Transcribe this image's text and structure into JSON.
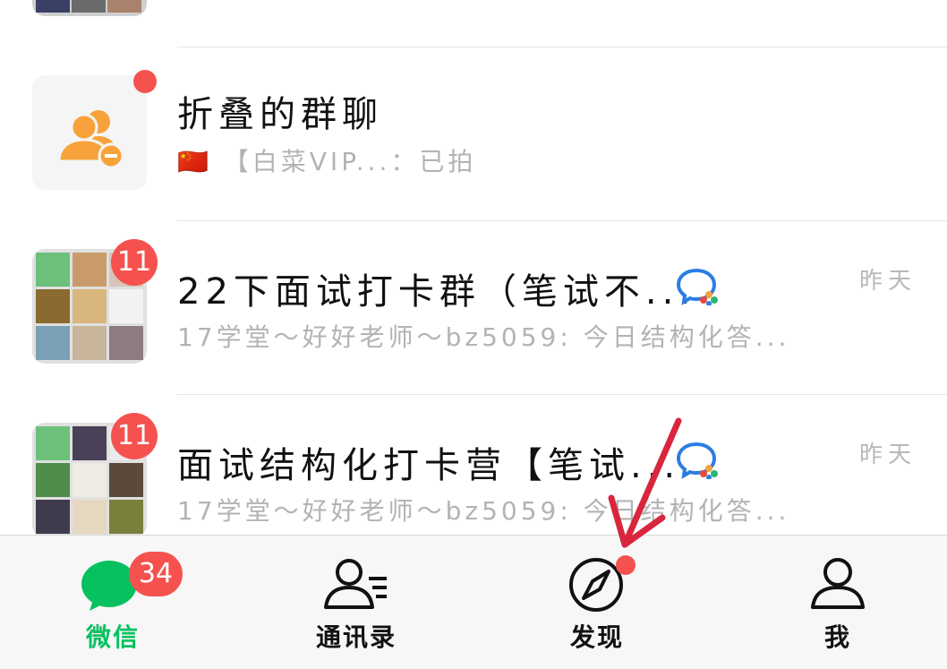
{
  "chats": [
    {
      "title": "折叠的群聊",
      "flag": "🇨🇳",
      "preview": "【白菜VIP...：已拍",
      "time": "",
      "badge": ""
    },
    {
      "title": "22下面试打卡群（笔试不...",
      "flag": "",
      "preview": "17学堂～好好老师～bz5059: 今日结构化答...",
      "time": "昨天",
      "badge": "11"
    },
    {
      "title": "面试结构化打卡营【笔试...",
      "flag": "",
      "preview": "17学堂～好好老师～bz5059: 今日结构化答...",
      "time": "昨天",
      "badge": "11"
    }
  ],
  "tabbar": {
    "items": [
      {
        "label": "微信",
        "icon": "chat-bubble-icon",
        "badge": "34",
        "active": true
      },
      {
        "label": "通讯录",
        "icon": "contacts-icon",
        "badge": "",
        "active": false
      },
      {
        "label": "发现",
        "icon": "compass-icon",
        "badge": "",
        "active": false
      },
      {
        "label": "我",
        "icon": "person-icon",
        "badge": "",
        "active": false
      }
    ]
  },
  "colors": {
    "accent": "#07c160",
    "badge": "#f5524f",
    "annotation_arrow": "#d7263d",
    "folded_icon": "#f7a23b"
  }
}
